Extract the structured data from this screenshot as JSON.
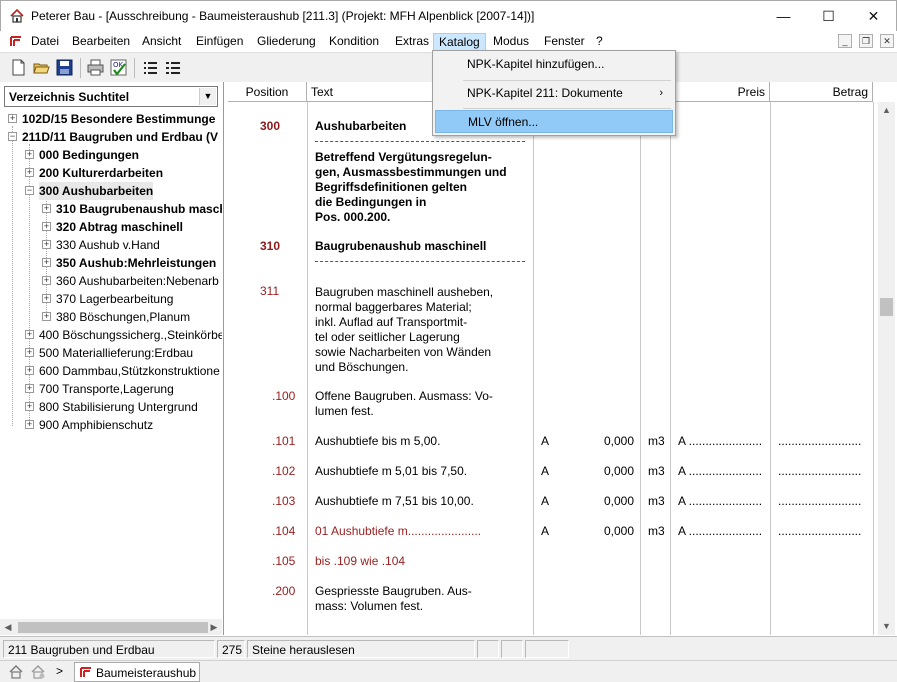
{
  "window": {
    "title": "Peterer Bau - [Ausschreibung - Baumeisteraushub [211.3]  (Projekt:  MFH Alpenblick  [2007-14])]",
    "controls": [
      "minimize",
      "maximize",
      "close"
    ]
  },
  "menu": {
    "items": [
      "Datei",
      "Bearbeiten",
      "Ansicht",
      "Einfügen",
      "Gliederung",
      "Kondition",
      "Extras",
      "Katalog",
      "Modus",
      "Fenster",
      "?"
    ],
    "active": "Katalog"
  },
  "dropdown": {
    "items": [
      {
        "label": "NPK-Kapitel hinzufügen..."
      },
      {
        "label": "NPK-Kapitel 211: Dokumente",
        "submenu_arrow": "›"
      },
      {
        "label": "MLV öffnen..."
      }
    ],
    "highlighted": "MLV öffnen..."
  },
  "left_panel": {
    "select_value": "Verzeichnis Suchtitel",
    "tree": [
      {
        "sign": "+",
        "label": "102D/15   Besondere Bestimmunge",
        "bold": true
      },
      {
        "sign": "−",
        "label": "211D/11   Baugruben und Erdbau  (V",
        "bold": true
      },
      {
        "sign": "+",
        "label": "000  Bedingungen",
        "bold": true
      },
      {
        "sign": "+",
        "label": "200  Kulturerdarbeiten",
        "bold": true
      },
      {
        "sign": "−",
        "label": "300  Aushubarbeiten",
        "bold": true,
        "selected": true
      },
      {
        "sign": "+",
        "label": "310  Baugrubenaushub maschi",
        "bold": true
      },
      {
        "sign": "+",
        "label": "320  Abtrag maschinell",
        "bold": true
      },
      {
        "sign": "+",
        "label": "330  Aushub v.Hand",
        "bold": false
      },
      {
        "sign": "+",
        "label": "350  Aushub:Mehrleistungen",
        "bold": true
      },
      {
        "sign": "+",
        "label": "360  Aushubarbeiten:Nebenarb",
        "bold": false
      },
      {
        "sign": "+",
        "label": "370  Lagerbearbeitung",
        "bold": false
      },
      {
        "sign": "+",
        "label": "380  Böschungen,Planum",
        "bold": false
      },
      {
        "sign": "+",
        "label": "400  Böschungssicherg.,Steinkörbe",
        "bold": false
      },
      {
        "sign": "+",
        "label": "500  Materiallieferung:Erdbau",
        "bold": false
      },
      {
        "sign": "+",
        "label": "600  Dammbau,Stützkonstruktione",
        "bold": false
      },
      {
        "sign": "+",
        "label": "700  Transporte,Lagerung",
        "bold": false
      },
      {
        "sign": "+",
        "label": "800  Stabilisierung Untergrund",
        "bold": false
      },
      {
        "sign": "+",
        "label": "900  Amphibienschutz",
        "bold": false
      }
    ]
  },
  "grid": {
    "headers": {
      "position": "Position",
      "text": "Text",
      "preis": "Preis",
      "betrag": "Betrag"
    },
    "rows": [
      {
        "pos": "300",
        "text": [
          "Aushubarbeiten"
        ],
        "bold": true
      },
      {
        "pos": "",
        "text": [
          "Betreffend Vergütungsregelun-",
          "gen, Ausmassbestimmungen und",
          "Begriffsdefinitionen gelten",
          "die Bedingungen in",
          "Pos. 000.200."
        ],
        "bold": true
      },
      {
        "pos": "310",
        "text": [
          "Baugrubenaushub maschinell"
        ],
        "bold": true
      },
      {
        "pos": "311",
        "text": [
          "Baugruben maschinell ausheben,",
          "normal baggerbares Material;",
          "inkl. Auflad auf Transportmit-",
          "tel oder seitlicher Lagerung",
          "sowie Nacharbeiten von Wänden",
          "und Böschungen."
        ]
      },
      {
        "pos": ".100",
        "text": [
          "Offene Baugruben. Ausmass: Vo-",
          "lumen fest."
        ]
      },
      {
        "pos": ".101",
        "text": [
          "Aushubtiefe bis m 5,00."
        ],
        "code": "A",
        "qty": "0,000",
        "unit": "m3",
        "price": "A ......................",
        "amount": "........................."
      },
      {
        "pos": ".102",
        "text": [
          "Aushubtiefe m 5,01 bis 7,50."
        ],
        "code": "A",
        "qty": "0,000",
        "unit": "m3",
        "price": "A ......................",
        "amount": "........................."
      },
      {
        "pos": ".103",
        "text": [
          "Aushubtiefe m 7,51 bis 10,00."
        ],
        "code": "A",
        "qty": "0,000",
        "unit": "m3",
        "price": "A ......................",
        "amount": "........................."
      },
      {
        "pos": ".104",
        "text": [
          "01  Aushubtiefe m......................"
        ],
        "red": true,
        "code": "A",
        "qty": "0,000",
        "unit": "m3",
        "price": "A ......................",
        "amount": "........................."
      },
      {
        "pos": ".105",
        "text": [
          "bis .109 wie .104"
        ],
        "red": true
      },
      {
        "pos": ".200",
        "text": [
          "Gespriesste Baugruben. Aus-",
          "mass: Volumen fest."
        ]
      }
    ]
  },
  "status": {
    "chapter": "211  Baugruben und Erdbau",
    "number": "275",
    "message": "Steine herauslesen"
  },
  "bottom": {
    "breadcrumb_sep": ">",
    "tab_label": "Baumeisteraushub"
  },
  "colors": {
    "position_dark": "#8b1a1a",
    "highlight": "#91c9f7",
    "menu_active": "#cce8ff"
  }
}
